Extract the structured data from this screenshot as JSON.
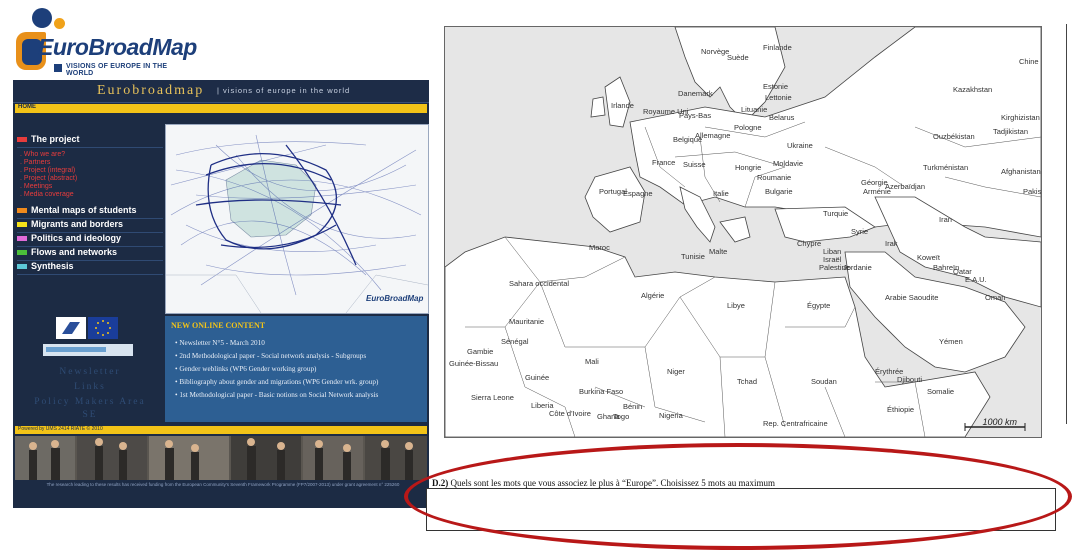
{
  "logo": {
    "wordmark": "EuroBroadMap",
    "tagline": "VISIONS OF EUROPE IN THE WORLD"
  },
  "site": {
    "title": "Eurobroadmap",
    "subtitle": "| visions of europe in the world",
    "home": "HOME",
    "nav": [
      {
        "label": "The project",
        "color": "#e73c3c",
        "sub": [
          ". Who we are?",
          ". Partners",
          ". Project (integral)",
          ". Project (abstract)",
          ". Meetings",
          ". Media coverage"
        ]
      },
      {
        "label": "Mental maps of students",
        "color": "#f08a1c"
      },
      {
        "label": "Migrants and borders",
        "color": "#f5e21a"
      },
      {
        "label": "Politics and ideology",
        "color": "#e06bd9"
      },
      {
        "label": "Flows and networks",
        "color": "#4bbf3a"
      },
      {
        "label": "Synthesis",
        "color": "#5cc7d6"
      }
    ],
    "news": {
      "title": "NEW ONLINE CONTENT",
      "items": [
        "Newsletter N°5 - March 2010",
        "2nd Methodological paper - Social network analysis - Subgroups",
        "Gender weblinks (WP6 Gender working group)",
        "Bibliography about gender and migrations (WP6 Gender wrk. group)",
        "1st Methodological paper - Basic notions on Social Network analysis"
      ]
    },
    "left_links": [
      "Newsletter",
      "Links",
      "Policy Makers Area",
      "SE"
    ],
    "powered": "Powered by UMS 2414 RIATE  © 2010",
    "credit": "The research leading to these results has received funding from the European Community's Seventh Framework Programme (FP7/2007-2013) under grant agreement n° 225260",
    "map_logo": "EuroBroadMap"
  },
  "map": {
    "scale": "1000 km",
    "labels": [
      {
        "t": "Norvège"
      },
      {
        "t": "Suède"
      },
      {
        "t": "Finlande"
      },
      {
        "t": "Danemark"
      },
      {
        "t": "Estonie"
      },
      {
        "t": "Lettonie"
      },
      {
        "t": "Lituanie"
      },
      {
        "t": "Irlande"
      },
      {
        "t": "Royaume Uni"
      },
      {
        "t": "Pays-Bas"
      },
      {
        "t": "Belarus"
      },
      {
        "t": "Pologne"
      },
      {
        "t": "Belgique"
      },
      {
        "t": "Allemagne"
      },
      {
        "t": "Ukraine"
      },
      {
        "t": "Moldavie"
      },
      {
        "t": "France"
      },
      {
        "t": "Suisse"
      },
      {
        "t": "Hongrie"
      },
      {
        "t": "Roumanie"
      },
      {
        "t": "Bulgarie"
      },
      {
        "t": "Italie"
      },
      {
        "t": "Portugal"
      },
      {
        "t": "Espagne"
      },
      {
        "t": "Turquie"
      },
      {
        "t": "Géorgie"
      },
      {
        "t": "Arménie"
      },
      {
        "t": "Azerbaïdjan"
      },
      {
        "t": "Kazakhstan"
      },
      {
        "t": "Ouzbékistan"
      },
      {
        "t": "Turkménistan"
      },
      {
        "t": "Kirghizistan"
      },
      {
        "t": "Tadjikistan"
      },
      {
        "t": "Afghanistan"
      },
      {
        "t": "Pakistan"
      },
      {
        "t": "Chine"
      },
      {
        "t": "Iran"
      },
      {
        "t": "Irak"
      },
      {
        "t": "Syrie"
      },
      {
        "t": "Chypre"
      },
      {
        "t": "Liban"
      },
      {
        "t": "Israël"
      },
      {
        "t": "Palestine"
      },
      {
        "t": "Jordanie"
      },
      {
        "t": "Koweït"
      },
      {
        "t": "Bahreïn"
      },
      {
        "t": "Qatar"
      },
      {
        "t": "E.A.U."
      },
      {
        "t": "Arabie Saoudite"
      },
      {
        "t": "Oman"
      },
      {
        "t": "Yémen"
      },
      {
        "t": "Malte"
      },
      {
        "t": "Tunisie"
      },
      {
        "t": "Maroc"
      },
      {
        "t": "Algérie"
      },
      {
        "t": "Libye"
      },
      {
        "t": "Égypte"
      },
      {
        "t": "Sahara occidental"
      },
      {
        "t": "Mauritanie"
      },
      {
        "t": "Mali"
      },
      {
        "t": "Niger"
      },
      {
        "t": "Tchad"
      },
      {
        "t": "Soudan"
      },
      {
        "t": "Érythrée"
      },
      {
        "t": "Djibouti"
      },
      {
        "t": "Somalie"
      },
      {
        "t": "Éthiopie"
      },
      {
        "t": "Sénégal"
      },
      {
        "t": "Gambie"
      },
      {
        "t": "Guinée-Bissau"
      },
      {
        "t": "Guinée"
      },
      {
        "t": "Sierra Leone"
      },
      {
        "t": "Liberia"
      },
      {
        "t": "Côte d'Ivoire"
      },
      {
        "t": "Burkina Faso"
      },
      {
        "t": "Ghana"
      },
      {
        "t": "Togo"
      },
      {
        "t": "Bénin"
      },
      {
        "t": "Nigeria"
      },
      {
        "t": "Rep. Centrafricaine"
      }
    ]
  },
  "question": {
    "number": "D.2)",
    "text": "Quels sont les mots que vous associez le plus à “Europe”. Choisissez 5 mots au maximum",
    "answer": ""
  },
  "colors": {
    "site_bg": "#1c2b44",
    "accent_yellow": "#f2c318",
    "highlight_ellipse": "#b81818",
    "brand_blue": "#1d3f7a",
    "brand_orange": "#e8901a"
  }
}
